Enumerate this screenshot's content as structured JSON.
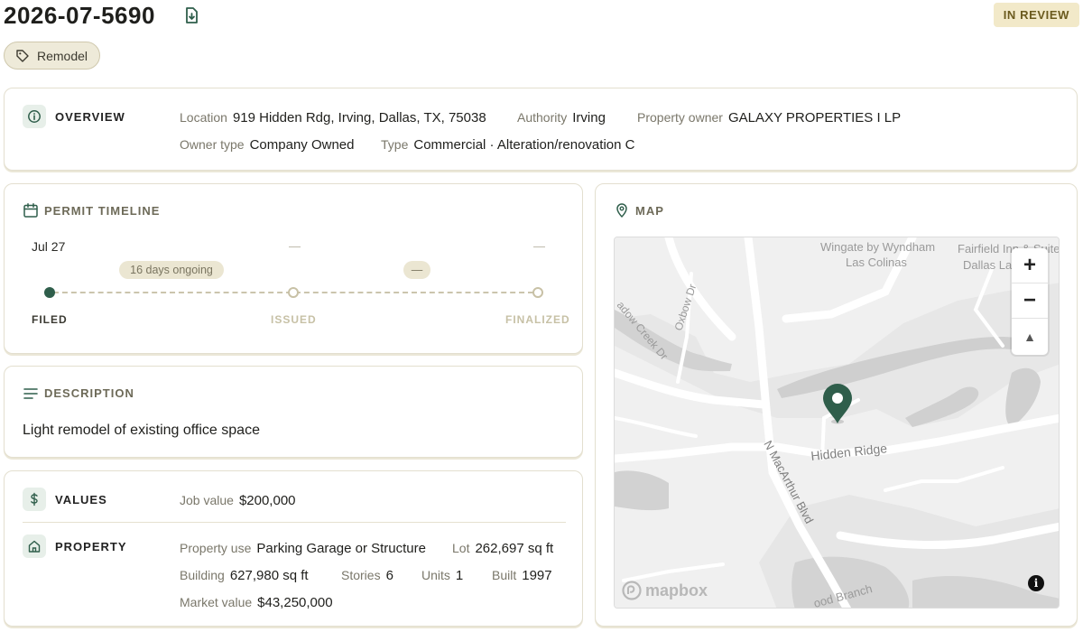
{
  "header": {
    "permit_number": "2026-07-5690",
    "status": "IN REVIEW",
    "tag": "Remodel"
  },
  "overview": {
    "title": "OVERVIEW",
    "location_label": "Location",
    "location": "919 Hidden Rdg, Irving, Dallas, TX, 75038",
    "authority_label": "Authority",
    "authority": "Irving",
    "owner_label": "Property owner",
    "owner": "GALAXY PROPERTIES I LP",
    "owner_type_label": "Owner type",
    "owner_type": "Company Owned",
    "type_label": "Type",
    "type": "Commercial · Alteration/renovation C"
  },
  "timeline": {
    "title": "PERMIT TIMELINE",
    "filed_date": "Jul 27",
    "issued_date": "—",
    "finalized_date": "—",
    "duration_pill": "16 days ongoing",
    "second_pill": "—",
    "filed_label": "FILED",
    "issued_label": "ISSUED",
    "finalized_label": "FINALIZED"
  },
  "description": {
    "title": "DESCRIPTION",
    "text": "Light remodel of existing office space"
  },
  "values": {
    "title": "VALUES",
    "job_value_label": "Job value",
    "job_value": "$200,000"
  },
  "property": {
    "title": "PROPERTY",
    "use_label": "Property use",
    "use": "Parking Garage or Structure",
    "lot_label": "Lot",
    "lot": "262,697 sq ft",
    "building_label": "Building",
    "building": "627,980 sq ft",
    "stories_label": "Stories",
    "stories": "6",
    "units_label": "Units",
    "units": "1",
    "built_label": "Built",
    "built": "1997",
    "market_label": "Market value",
    "market": "$43,250,000"
  },
  "map": {
    "title": "MAP",
    "zoom_in": "+",
    "zoom_out": "−",
    "compass": "▲",
    "logo": "mapbox",
    "info": "i",
    "labels": {
      "wingate": "Wingate by Wyndham",
      "las_colinas": "Las Colinas",
      "fairfield": "Fairfield Inn & Suite",
      "dallas_la": "Dallas La",
      "oxbow": "Oxbow Dr",
      "meadow_creek": "adow Creek Dr",
      "hidden_ridge": "Hidden Ridge",
      "macarthur": "N MacArthur Blvd",
      "wood_branch": "ood Branch"
    }
  },
  "colors": {
    "accent": "#2f5e4b",
    "badge_bg": "#f2e9c9",
    "tag_bg": "#eeead9"
  }
}
